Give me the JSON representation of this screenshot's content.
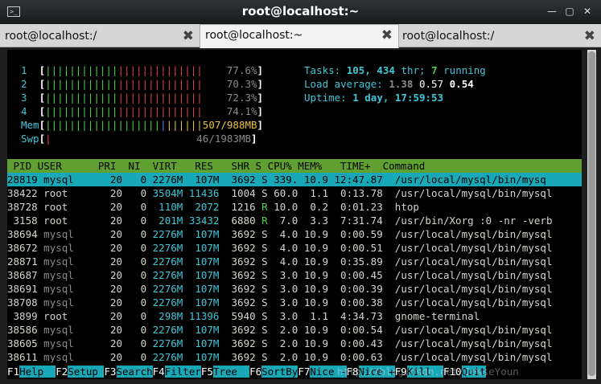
{
  "window": {
    "title": "root@localhost:~"
  },
  "tabs": [
    {
      "label": "root@localhost:/"
    },
    {
      "label": "root@localhost:~"
    },
    {
      "label": "root@localhost:/"
    }
  ],
  "htop": {
    "cpus": [
      {
        "num": "1",
        "pct": "77.6%"
      },
      {
        "num": "2",
        "pct": "70.3%"
      },
      {
        "num": "3",
        "pct": "72.3%"
      },
      {
        "num": "4",
        "pct": "74.1%"
      }
    ],
    "mem": {
      "label": "Mem",
      "value": "507/988MB"
    },
    "swp": {
      "label": "Swp",
      "value": "46/1983MB"
    },
    "tasks": {
      "label": "Tasks:",
      "count": "105,",
      "thr": "434",
      "thr_label": "thr;",
      "running": "7",
      "running_label": "running"
    },
    "load": {
      "label": "Load average:",
      "v1": "1.38",
      "v2": "0.57",
      "v3": "0.54"
    },
    "uptime": {
      "label": "Uptime:",
      "value": "1 day, 17:59:53"
    },
    "header": " PID USER      PRI  NI  VIRT   RES   SHR S CPU% MEM%   TIME+  Command",
    "processes": [
      {
        "pid": "28819",
        "user": "mysql",
        "pri": "20",
        "ni": "0",
        "virt": "2276M",
        "res": "107M",
        "shr": "3692",
        "s": "S",
        "cpu": "339.",
        "mem": "10.9",
        "time": "12:47.87",
        "cmd": "/usr/local/mysql/bin/mysq"
      },
      {
        "pid": "38422",
        "user": "root",
        "pri": "20",
        "ni": "0",
        "virt": "3504M",
        "res": "11436",
        "shr": "1004",
        "s": "S",
        "cpu": "60.0",
        "mem": "1.1",
        "time": "0:13.78",
        "cmd": "/usr/local/mysql/bin/mysql"
      },
      {
        "pid": "38728",
        "user": "root",
        "pri": "20",
        "ni": "0",
        "virt": "110M",
        "res": "2072",
        "shr": "1216",
        "s": "R",
        "cpu": "10.0",
        "mem": "0.2",
        "time": "0:01.23",
        "cmd": "htop"
      },
      {
        "pid": "3158",
        "user": "root",
        "pri": "20",
        "ni": "0",
        "virt": "201M",
        "res": "33432",
        "shr": "6880",
        "s": "R",
        "cpu": "7.0",
        "mem": "3.3",
        "time": "7:31.74",
        "cmd": "/usr/bin/Xorg :0 -nr -verb"
      },
      {
        "pid": "38694",
        "user": "mysql",
        "pri": "20",
        "ni": "0",
        "virt": "2276M",
        "res": "107M",
        "shr": "3692",
        "s": "S",
        "cpu": "4.0",
        "mem": "10.9",
        "time": "0:00.59",
        "cmd": "/usr/local/mysql/bin/mysql"
      },
      {
        "pid": "38672",
        "user": "mysql",
        "pri": "20",
        "ni": "0",
        "virt": "2276M",
        "res": "107M",
        "shr": "3692",
        "s": "S",
        "cpu": "4.0",
        "mem": "10.9",
        "time": "0:00.51",
        "cmd": "/usr/local/mysql/bin/mysql"
      },
      {
        "pid": "28871",
        "user": "mysql",
        "pri": "20",
        "ni": "0",
        "virt": "2276M",
        "res": "107M",
        "shr": "3692",
        "s": "S",
        "cpu": "4.0",
        "mem": "10.9",
        "time": "0:35.89",
        "cmd": "/usr/local/mysql/bin/mysql"
      },
      {
        "pid": "38687",
        "user": "mysql",
        "pri": "20",
        "ni": "0",
        "virt": "2276M",
        "res": "107M",
        "shr": "3692",
        "s": "S",
        "cpu": "3.0",
        "mem": "10.9",
        "time": "0:00.45",
        "cmd": "/usr/local/mysql/bin/mysql"
      },
      {
        "pid": "38691",
        "user": "mysql",
        "pri": "20",
        "ni": "0",
        "virt": "2276M",
        "res": "107M",
        "shr": "3692",
        "s": "S",
        "cpu": "3.0",
        "mem": "10.9",
        "time": "0:00.39",
        "cmd": "/usr/local/mysql/bin/mysql"
      },
      {
        "pid": "38708",
        "user": "mysql",
        "pri": "20",
        "ni": "0",
        "virt": "2276M",
        "res": "107M",
        "shr": "3692",
        "s": "S",
        "cpu": "3.0",
        "mem": "10.9",
        "time": "0:00.38",
        "cmd": "/usr/local/mysql/bin/mysql"
      },
      {
        "pid": "3899",
        "user": "root",
        "pri": "20",
        "ni": "0",
        "virt": "298M",
        "res": "11396",
        "shr": "5940",
        "s": "S",
        "cpu": "3.0",
        "mem": "1.1",
        "time": "4:34.73",
        "cmd": "gnome-terminal"
      },
      {
        "pid": "38586",
        "user": "mysql",
        "pri": "20",
        "ni": "0",
        "virt": "2276M",
        "res": "107M",
        "shr": "3692",
        "s": "S",
        "cpu": "2.0",
        "mem": "10.9",
        "time": "0:00.54",
        "cmd": "/usr/local/mysql/bin/mysql"
      },
      {
        "pid": "38605",
        "user": "mysql",
        "pri": "20",
        "ni": "0",
        "virt": "2276M",
        "res": "107M",
        "shr": "3692",
        "s": "S",
        "cpu": "2.0",
        "mem": "10.9",
        "time": "0:00.43",
        "cmd": "/usr/local/mysql/bin/mysql"
      },
      {
        "pid": "38611",
        "user": "mysql",
        "pri": "20",
        "ni": "0",
        "virt": "2276M",
        "res": "107M",
        "shr": "3692",
        "s": "S",
        "cpu": "2.0",
        "mem": "10.9",
        "time": "0:00.63",
        "cmd": "/usr/local/mysql/bin/mysql"
      }
    ],
    "fkeys": [
      {
        "key": "F1",
        "label": "Help  "
      },
      {
        "key": "F2",
        "label": "Setup "
      },
      {
        "key": "F3",
        "label": "Search"
      },
      {
        "key": "F4",
        "label": "Filter"
      },
      {
        "key": "F5",
        "label": "Tree  "
      },
      {
        "key": "F6",
        "label": "SortBy"
      },
      {
        "key": "F7",
        "label": "Nice -"
      },
      {
        "key": "F8",
        "label": "Nice +"
      },
      {
        "key": "F9",
        "label": "Kill  "
      },
      {
        "key": "F10",
        "label": "Quit"
      }
    ],
    "watermark": "http://blog.csdn.net/JesseYoun"
  },
  "colors": {
    "header_bg": "#5fa030",
    "selected_bg": "#19a8b8",
    "bar_green": "#4ad04a",
    "bar_red": "#e34040",
    "cyan": "#3fc6d8"
  },
  "icons": [
    "terminal-icon",
    "minimize-icon",
    "maximize-icon",
    "close-icon",
    "tab-close-icon"
  ]
}
